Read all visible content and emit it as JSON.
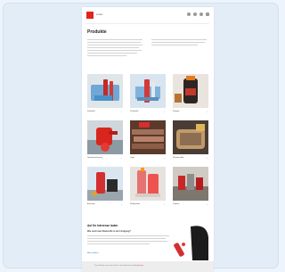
{
  "header": {
    "brand": "Loctite",
    "icons": [
      "search-icon",
      "user-icon",
      "globe-icon",
      "menu-icon"
    ]
  },
  "colors": {
    "brand_red": "#e1251b",
    "page_bg": "#eef4fb"
  },
  "page": {
    "title": "Produkte",
    "intro_left": "",
    "intro_right": ""
  },
  "products": [
    {
      "name": "Klebstoffe",
      "image": "blue-red-glue-dispenser"
    },
    {
      "name": "Dichtstoffe",
      "image": "cartridge-applicator"
    },
    {
      "name": "Reiniger",
      "image": "dark-bottle-orange-cap"
    },
    {
      "name": "Gewindesicherung",
      "image": "red-threadlocker-dropper"
    },
    {
      "name": "Lager",
      "image": "copper-sheets-stacked"
    },
    {
      "name": "Schmierstoffe",
      "image": "brush-on-bolt"
    },
    {
      "name": "Anaerobe",
      "image": "red-bottle-bearings"
    },
    {
      "name": "Klebebänder",
      "image": "orange-bottle-pack"
    },
    {
      "name": "Zubehör",
      "image": "bottles-on-metal"
    }
  ],
  "featured": {
    "title": "Auf Ihr Interesse laden",
    "subtitle": "Wie nutzt man Klebstoffe in der Fertigung?",
    "link": "Mehr erfahren",
    "image": "robot-arm-dispensing"
  },
  "footer": {
    "text": "Diese Website verwendet Cookies. Mehr Informationen",
    "link": "Einstellungen"
  }
}
